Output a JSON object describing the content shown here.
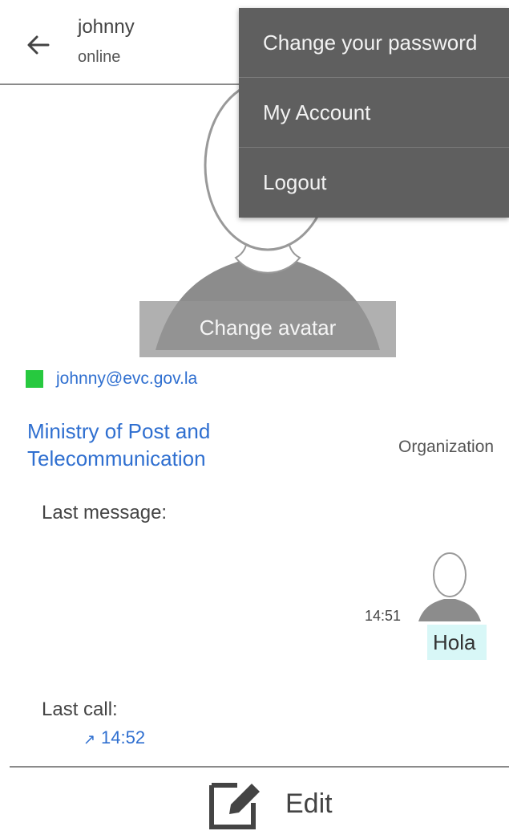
{
  "header": {
    "contact_name": "johnny",
    "contact_status": "online"
  },
  "menu": {
    "items": [
      "Change your password",
      "My Account",
      "Logout"
    ]
  },
  "profile": {
    "change_avatar_label": "Change avatar",
    "email": "johnny@evc.gov.la",
    "status_color": "#27c93f",
    "organization_name_line1": "Ministry of Post and",
    "organization_name_line2": "Telecommunication",
    "organization_label": "Organization"
  },
  "last_message": {
    "title": "Last message:",
    "time": "14:51",
    "text": "Hola"
  },
  "last_call": {
    "title": "Last call:",
    "direction_icon": "arrow-outgoing-icon",
    "time": "14:52"
  },
  "footer": {
    "edit_label": "Edit"
  },
  "colors": {
    "link_blue": "#2f6fd0",
    "menu_bg": "#5f5f5f",
    "bubble_bg": "#d8f7f7"
  }
}
